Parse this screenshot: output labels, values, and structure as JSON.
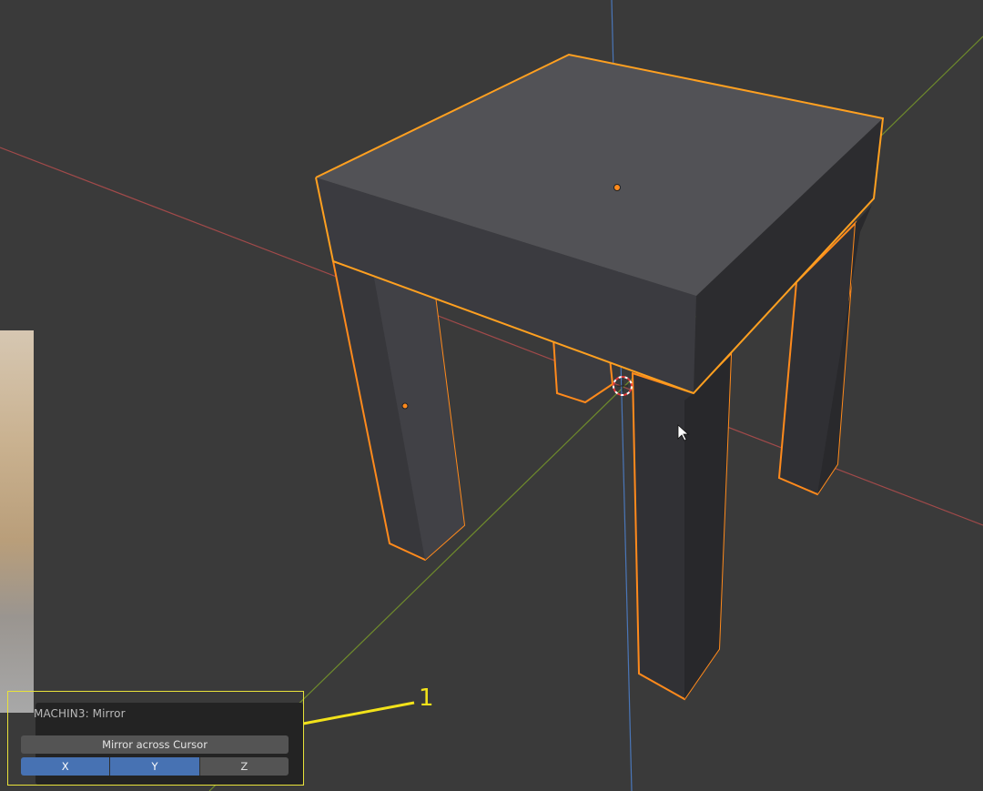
{
  "viewport": {
    "object_name": "stool",
    "background_color": "#3a3a3a",
    "selection_outline_color": "#ff8a1c",
    "x_axis_color": "#a14a4a",
    "y_axis_color": "#6e8a2c",
    "z_axis_color": "#4a76b8",
    "cursor_icon": "3d-cursor-icon",
    "mouse_icon": "mouse-pointer-icon"
  },
  "operator_panel": {
    "title": "MACHIN3: Mirror",
    "mirror_button_label": "Mirror across Cursor",
    "axes": [
      {
        "label": "X",
        "active": true
      },
      {
        "label": "Y",
        "active": true
      },
      {
        "label": "Z",
        "active": false
      }
    ]
  },
  "annotation": {
    "number": "1",
    "color": "#f2e21a"
  }
}
